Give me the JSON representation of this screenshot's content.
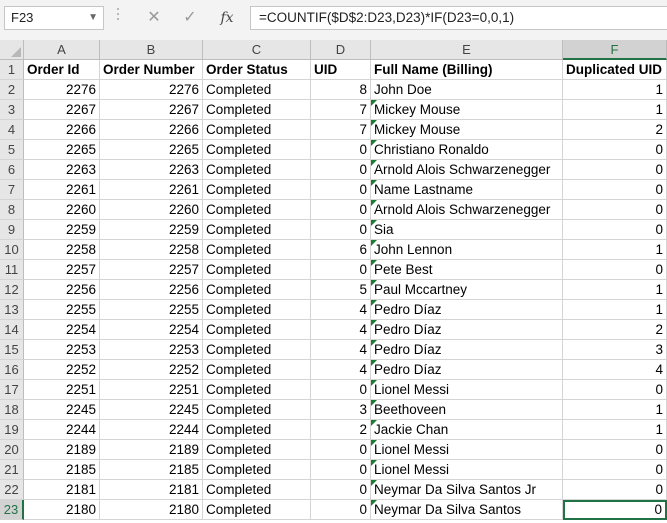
{
  "formula_bar": {
    "name_box": "F23",
    "cancel_icon": "✕",
    "enter_icon": "✓",
    "fx_label": "fx",
    "formula": "=COUNTIF($D$2:D23,D23)*IF(D23=0,0,1)"
  },
  "columns": [
    "A",
    "B",
    "C",
    "D",
    "E",
    "F"
  ],
  "header": {
    "row_number": "1",
    "cells": [
      "Order Id",
      "Order Number",
      "Order Status",
      "UID",
      "Full Name (Billing)",
      "Duplicated UID"
    ]
  },
  "rows": [
    {
      "n": "2",
      "order_id": "2276",
      "order_number": "2276",
      "status": "Completed",
      "uid": "8",
      "name": "John Doe",
      "dup": "1"
    },
    {
      "n": "3",
      "order_id": "2267",
      "order_number": "2267",
      "status": "Completed",
      "uid": "7",
      "name": "Mickey Mouse",
      "dup": "1"
    },
    {
      "n": "4",
      "order_id": "2266",
      "order_number": "2266",
      "status": "Completed",
      "uid": "7",
      "name": "Mickey Mouse",
      "dup": "2"
    },
    {
      "n": "5",
      "order_id": "2265",
      "order_number": "2265",
      "status": "Completed",
      "uid": "0",
      "name": "Christiano Ronaldo",
      "dup": "0"
    },
    {
      "n": "6",
      "order_id": "2263",
      "order_number": "2263",
      "status": "Completed",
      "uid": "0",
      "name": "Arnold Alois Schwarzenegger",
      "dup": "0"
    },
    {
      "n": "7",
      "order_id": "2261",
      "order_number": "2261",
      "status": "Completed",
      "uid": "0",
      "name": "Name Lastname",
      "dup": "0"
    },
    {
      "n": "8",
      "order_id": "2260",
      "order_number": "2260",
      "status": "Completed",
      "uid": "0",
      "name": "Arnold Alois Schwarzenegger",
      "dup": "0"
    },
    {
      "n": "9",
      "order_id": "2259",
      "order_number": "2259",
      "status": "Completed",
      "uid": "0",
      "name": "Sia",
      "dup": "0"
    },
    {
      "n": "10",
      "order_id": "2258",
      "order_number": "2258",
      "status": "Completed",
      "uid": "6",
      "name": "John Lennon",
      "dup": "1"
    },
    {
      "n": "11",
      "order_id": "2257",
      "order_number": "2257",
      "status": "Completed",
      "uid": "0",
      "name": "Pete Best",
      "dup": "0"
    },
    {
      "n": "12",
      "order_id": "2256",
      "order_number": "2256",
      "status": "Completed",
      "uid": "5",
      "name": "Paul Mccartney",
      "dup": "1"
    },
    {
      "n": "13",
      "order_id": "2255",
      "order_number": "2255",
      "status": "Completed",
      "uid": "4",
      "name": "Pedro Díaz",
      "dup": "1"
    },
    {
      "n": "14",
      "order_id": "2254",
      "order_number": "2254",
      "status": "Completed",
      "uid": "4",
      "name": "Pedro Díaz",
      "dup": "2"
    },
    {
      "n": "15",
      "order_id": "2253",
      "order_number": "2253",
      "status": "Completed",
      "uid": "4",
      "name": "Pedro Díaz",
      "dup": "3"
    },
    {
      "n": "16",
      "order_id": "2252",
      "order_number": "2252",
      "status": "Completed",
      "uid": "4",
      "name": "Pedro Díaz",
      "dup": "4"
    },
    {
      "n": "17",
      "order_id": "2251",
      "order_number": "2251",
      "status": "Completed",
      "uid": "0",
      "name": "Lionel Messi",
      "dup": "0"
    },
    {
      "n": "18",
      "order_id": "2245",
      "order_number": "2245",
      "status": "Completed",
      "uid": "3",
      "name": "Beethoveen",
      "dup": "1"
    },
    {
      "n": "19",
      "order_id": "2244",
      "order_number": "2244",
      "status": "Completed",
      "uid": "2",
      "name": "Jackie Chan",
      "dup": "1"
    },
    {
      "n": "20",
      "order_id": "2189",
      "order_number": "2189",
      "status": "Completed",
      "uid": "0",
      "name": "Lionel Messi",
      "dup": "0"
    },
    {
      "n": "21",
      "order_id": "2185",
      "order_number": "2185",
      "status": "Completed",
      "uid": "0",
      "name": "Lionel Messi",
      "dup": "0"
    },
    {
      "n": "22",
      "order_id": "2181",
      "order_number": "2181",
      "status": "Completed",
      "uid": "0",
      "name": "Neymar Da Silva Santos Jr",
      "dup": "0"
    },
    {
      "n": "23",
      "order_id": "2180",
      "order_number": "2180",
      "status": "Completed",
      "uid": "0",
      "name": "Neymar Da Silva Santos",
      "dup": "0"
    }
  ],
  "selection": {
    "cell": "F23",
    "column": "F",
    "row": "23"
  },
  "colors": {
    "selection_green": "#217346",
    "error_indicator": "#1e7b34"
  }
}
